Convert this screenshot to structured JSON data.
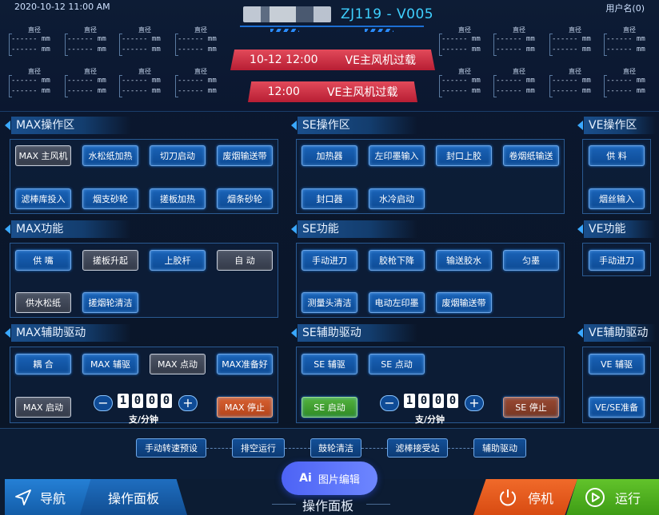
{
  "header": {
    "datetime": "2020-10-12 11:00 AM",
    "user": "用户名(0)",
    "machine_title": "ZJ119 - V005",
    "gauge_label": "直径",
    "gauge_value": "------ mm",
    "alarms": [
      {
        "time": "10-12 12:00",
        "message": "VE主风机过载"
      },
      {
        "time": "12:00",
        "message": "VE主风机过载"
      }
    ]
  },
  "sections": {
    "max_ops": {
      "title": "MAX操作区",
      "buttons": [
        "MAX 主风机",
        "水松纸加热",
        "切刀启动",
        "废烟输送带",
        "滤棒库投入",
        "烟支砂轮",
        "搓板加热",
        "烟条砂轮"
      ]
    },
    "se_ops": {
      "title": "SE操作区",
      "buttons": [
        "加热器",
        "左印墨输入",
        "封口上胶",
        "卷烟纸输送",
        "封口器",
        "水冷启动"
      ]
    },
    "ve_ops": {
      "title": "VE操作区",
      "buttons": [
        "供 料",
        "烟丝输入"
      ]
    },
    "max_func": {
      "title": "MAX功能",
      "buttons": [
        "供 嘴",
        "搓板升起",
        "上胶杆",
        "自 动",
        "供水松纸",
        "搓烟轮清洁"
      ]
    },
    "se_func": {
      "title": "SE功能",
      "buttons": [
        "手动进刀",
        "胶枪下降",
        "输送胶水",
        "匀墨",
        "测量头清洁",
        "电动左印墨",
        "废烟输送带"
      ]
    },
    "ve_func": {
      "title": "VE功能",
      "buttons": [
        "手动进刀"
      ]
    },
    "max_aux": {
      "title": "MAX辅助驱动",
      "buttons": [
        "耦 合",
        "MAX 辅驱",
        "MAX 点动",
        "MAX准备好",
        "MAX 启动",
        "MAX 停止"
      ],
      "counter_digits": [
        "1",
        "0",
        "0",
        "0"
      ],
      "unit": "支/分钟"
    },
    "se_aux": {
      "title": "SE辅助驱动",
      "buttons": [
        "SE 辅驱",
        "SE 点动",
        "SE 启动",
        "SE 停止"
      ],
      "counter_digits": [
        "1",
        "0",
        "0",
        "0"
      ],
      "unit": "支/分钟"
    },
    "ve_aux": {
      "title": "VE辅助驱动",
      "buttons": [
        "VE 辅驱",
        "VE/SE准备"
      ]
    }
  },
  "modes": [
    "手动转速预设",
    "排空运行",
    "鼓轮清洁",
    "滤棒接受站",
    "辅助驱动"
  ],
  "footer": {
    "nav": "导航",
    "panel": "操作面板",
    "ai_badge": "图片编辑",
    "ai_prefix": "Ai",
    "title": "操作面板",
    "stop": "停机",
    "run": "运行"
  },
  "colors": {
    "accent_blue": "#1a63b8",
    "alarm_red": "#d8283f",
    "stop_orange": "#f06a2a",
    "run_green": "#62c32b",
    "title_cyan": "#3fd0ff"
  }
}
